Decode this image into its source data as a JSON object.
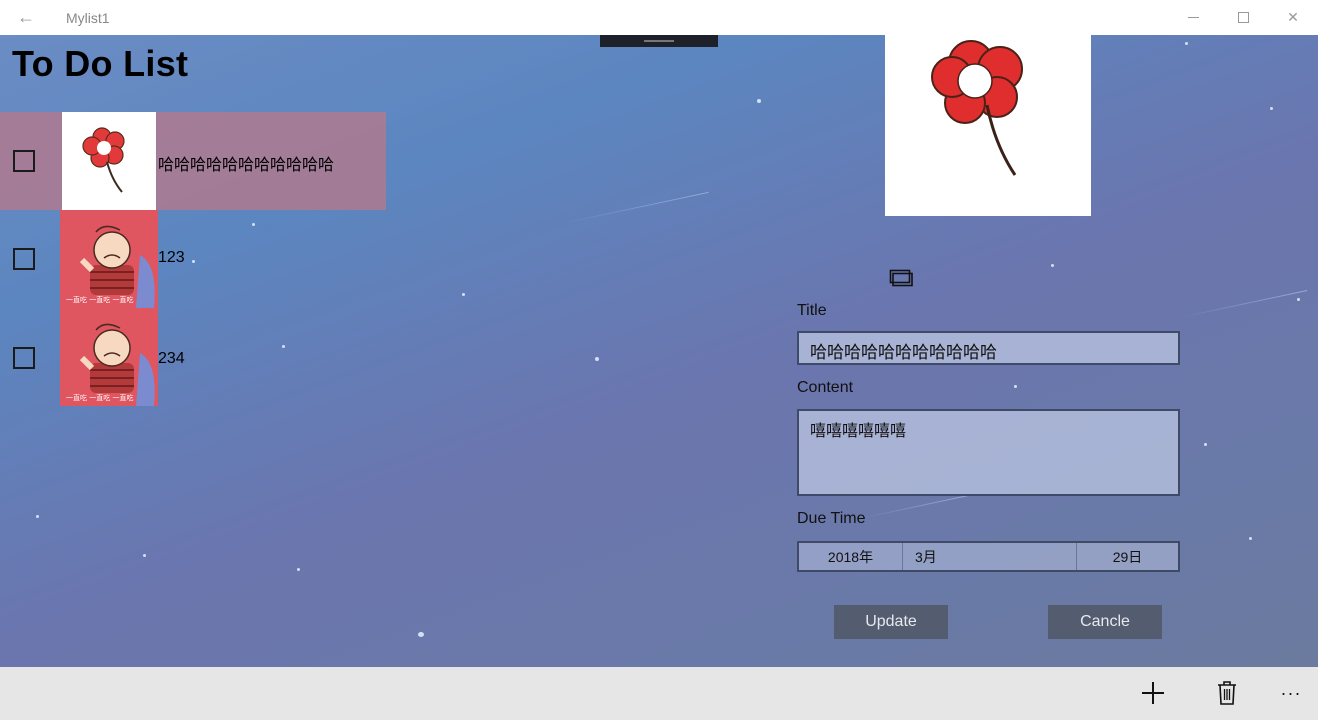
{
  "window": {
    "title": "Mylist1",
    "back_glyph": "←",
    "close_glyph": "✕"
  },
  "page": {
    "title": "To Do List"
  },
  "items": [
    {
      "label": "哈哈哈哈哈哈哈哈哈哈哈",
      "checked": false,
      "selected": true,
      "image": "flower-image"
    },
    {
      "label": "123",
      "checked": false,
      "selected": false,
      "image": "cartoon-boy-image"
    },
    {
      "label": "234",
      "checked": false,
      "selected": false,
      "image": "cartoon-boy-image"
    }
  ],
  "cartoon_caption": "一直吃 一直吃 一直吃",
  "detail": {
    "title_label": "Title",
    "title_value": "哈哈哈哈哈哈哈哈哈哈哈",
    "content_label": "Content",
    "content_value": "嘻嘻嘻嘻嘻嘻",
    "due_label": "Due Time",
    "date": {
      "year": "2018年",
      "month": "3月",
      "day": "29日"
    },
    "update_label": "Update",
    "cancel_label": "Cancle"
  },
  "commands": {
    "add_icon": "add-icon",
    "delete_icon": "trash-icon",
    "more_glyph": "···"
  },
  "colors": {
    "selected_row": "#b6788c",
    "button": "#545c70",
    "command_bar": "#e6e6e6"
  }
}
